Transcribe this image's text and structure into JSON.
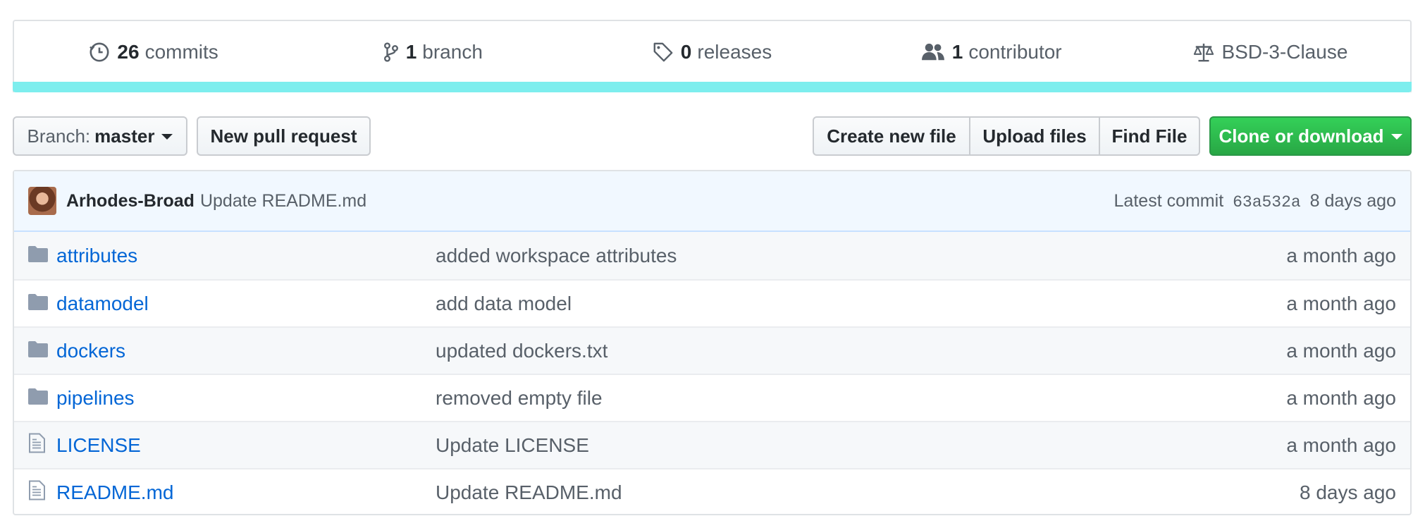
{
  "summary": {
    "commits": {
      "count": "26",
      "label": "commits",
      "icon": "history-icon"
    },
    "branches": {
      "count": "1",
      "label": "branch",
      "icon": "git-branch-icon"
    },
    "releases": {
      "count": "0",
      "label": "releases",
      "icon": "tag-icon"
    },
    "contributors": {
      "count": "1",
      "label": "contributor",
      "icon": "people-icon"
    },
    "license": {
      "label": "BSD-3-Clause",
      "icon": "law-icon"
    },
    "language_bar_color": "#7deeee"
  },
  "toolbar": {
    "branch_prefix": "Branch:",
    "branch_name": "master",
    "new_pull_request": "New pull request",
    "create_new_file": "Create new file",
    "upload_files": "Upload files",
    "find_file": "Find File",
    "clone_or_download": "Clone or download",
    "clone_color": "#28a745"
  },
  "latest_commit": {
    "author": "Arhodes-Broad",
    "message": "Update README.md",
    "prefix": "Latest commit",
    "sha": "63a532a",
    "age": "8 days ago"
  },
  "files": [
    {
      "type": "folder",
      "name": "attributes",
      "message": "added workspace attributes",
      "age": "a month ago"
    },
    {
      "type": "folder",
      "name": "datamodel",
      "message": "add data model",
      "age": "a month ago"
    },
    {
      "type": "folder",
      "name": "dockers",
      "message": "updated dockers.txt",
      "age": "a month ago"
    },
    {
      "type": "folder",
      "name": "pipelines",
      "message": "removed empty file",
      "age": "a month ago"
    },
    {
      "type": "file",
      "name": "LICENSE",
      "message": "Update LICENSE",
      "age": "a month ago"
    },
    {
      "type": "file",
      "name": "README.md",
      "message": "Update README.md",
      "age": "8 days ago"
    }
  ]
}
